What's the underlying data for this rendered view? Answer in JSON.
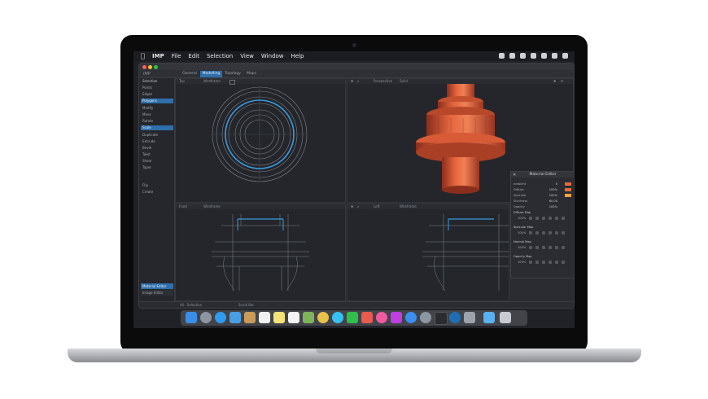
{
  "menubar": {
    "app_name": "IMP",
    "items": [
      "File",
      "Edit",
      "Selection",
      "View",
      "Window",
      "Help"
    ]
  },
  "toolbar": {
    "brand": "IMP",
    "tabs": [
      "General",
      "Modelling",
      "Topology",
      "Maps"
    ],
    "active_tab": "Modelling"
  },
  "sidebar": {
    "items": [
      "Points",
      "Edges",
      "Polygons",
      "Modify",
      "Move",
      "Rotate",
      "Scale",
      "Duplicate",
      "Extrude",
      "Bevel",
      "Twist",
      "Shear",
      "Taper",
      "Flip",
      "Create"
    ],
    "selected": [
      "Polygons",
      "Scale"
    ],
    "section_label": "Selection",
    "bottom_buttons": [
      "Material Editor",
      "Image Editor"
    ]
  },
  "viewports": {
    "top_left": {
      "name": "Top",
      "mode": "Wireframe"
    },
    "top_right": {
      "name": "Perspective",
      "mode": "Solid"
    },
    "bottom_left": {
      "name": "Front",
      "mode": "Wireframe"
    },
    "bottom_right": {
      "name": "Left",
      "mode": "Wireframe"
    }
  },
  "material_editor": {
    "title": "Material Editor",
    "rows": [
      {
        "label": "Ambient",
        "value": "0"
      },
      {
        "label": "Diffuse",
        "value": "100%"
      },
      {
        "label": "Specular",
        "value": "100%"
      },
      {
        "label": "Shininess",
        "value": "60.00"
      },
      {
        "label": "Opacity",
        "value": "100%"
      }
    ],
    "maps": [
      "Diffuse Map",
      "Specular Map",
      "Normal Map",
      "Opacity Map"
    ],
    "map_value": "100%",
    "swatch_colors": [
      "#e26c37",
      "#f1a23a"
    ]
  },
  "statusbar": {
    "selection_label": "All · Selection",
    "extra": "Scroll Bar"
  },
  "colors": {
    "accent": "#2f6fab",
    "model": "#e0603a",
    "wire": "#3a9ae0"
  }
}
